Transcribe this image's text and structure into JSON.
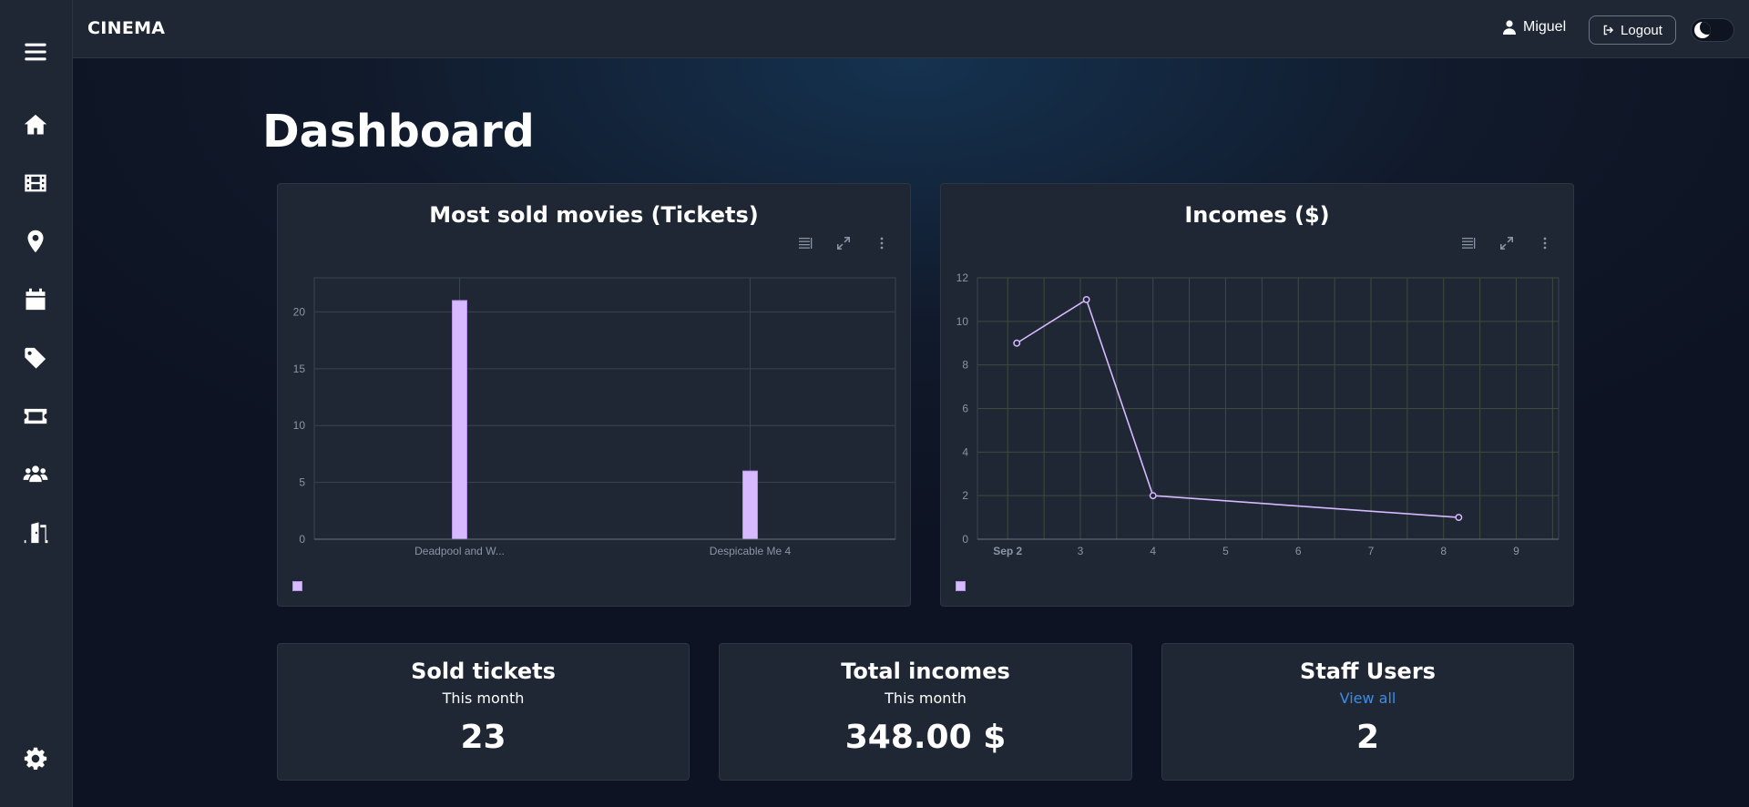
{
  "app": {
    "brand": "CINEMA"
  },
  "user": {
    "name": "Miguel",
    "logout_label": "Logout"
  },
  "sidebar": {
    "items": [
      {
        "name": "menu",
        "icon": "hamburger-icon"
      },
      {
        "name": "home",
        "icon": "home-icon"
      },
      {
        "name": "movies",
        "icon": "film-icon"
      },
      {
        "name": "locations",
        "icon": "map-pin-icon"
      },
      {
        "name": "calendar",
        "icon": "calendar-icon"
      },
      {
        "name": "tags",
        "icon": "tag-icon"
      },
      {
        "name": "tickets",
        "icon": "ticket-icon"
      },
      {
        "name": "users",
        "icon": "users-icon"
      },
      {
        "name": "rooms",
        "icon": "door-icon"
      },
      {
        "name": "settings",
        "icon": "gear-icon"
      }
    ]
  },
  "page": {
    "title": "Dashboard"
  },
  "charts": {
    "movies": {
      "title": "Most sold movies (Tickets)"
    },
    "incomes": {
      "title": "Incomes ($)"
    }
  },
  "chart_data": [
    {
      "type": "bar",
      "title": "Most sold movies (Tickets)",
      "categories": [
        "Deadpool and W...",
        "Despicable Me 4"
      ],
      "values": [
        21,
        6
      ],
      "ylim": [
        0,
        23
      ],
      "yticks": [
        0,
        5,
        10,
        15,
        20
      ],
      "grid": true,
      "color": "#d7b9ff"
    },
    {
      "type": "line",
      "title": "Incomes ($)",
      "x": [
        "2024-09-02T03:00",
        "2024-09-03T02:00",
        "2024-09-04T00:00",
        "2024-09-08T05:00"
      ],
      "y": [
        9,
        11,
        2,
        1
      ],
      "xticks": [
        "Sep 2",
        "3",
        "4",
        "5",
        "6",
        "7",
        "8",
        "9"
      ],
      "yticks": [
        0,
        2,
        4,
        6,
        8,
        10,
        12
      ],
      "ylim": [
        0,
        12
      ],
      "grid": true,
      "color": "#d7b9ff"
    }
  ],
  "stats": [
    {
      "title": "Sold tickets",
      "subtitle": "This month",
      "value": "23"
    },
    {
      "title": "Total incomes",
      "subtitle": "This month",
      "value": "348.00 $"
    },
    {
      "title": "Staff Users",
      "link": "View all",
      "value": "2"
    }
  ],
  "theme": {
    "accent": "#d7b9ff",
    "link": "#3b8ce8"
  }
}
